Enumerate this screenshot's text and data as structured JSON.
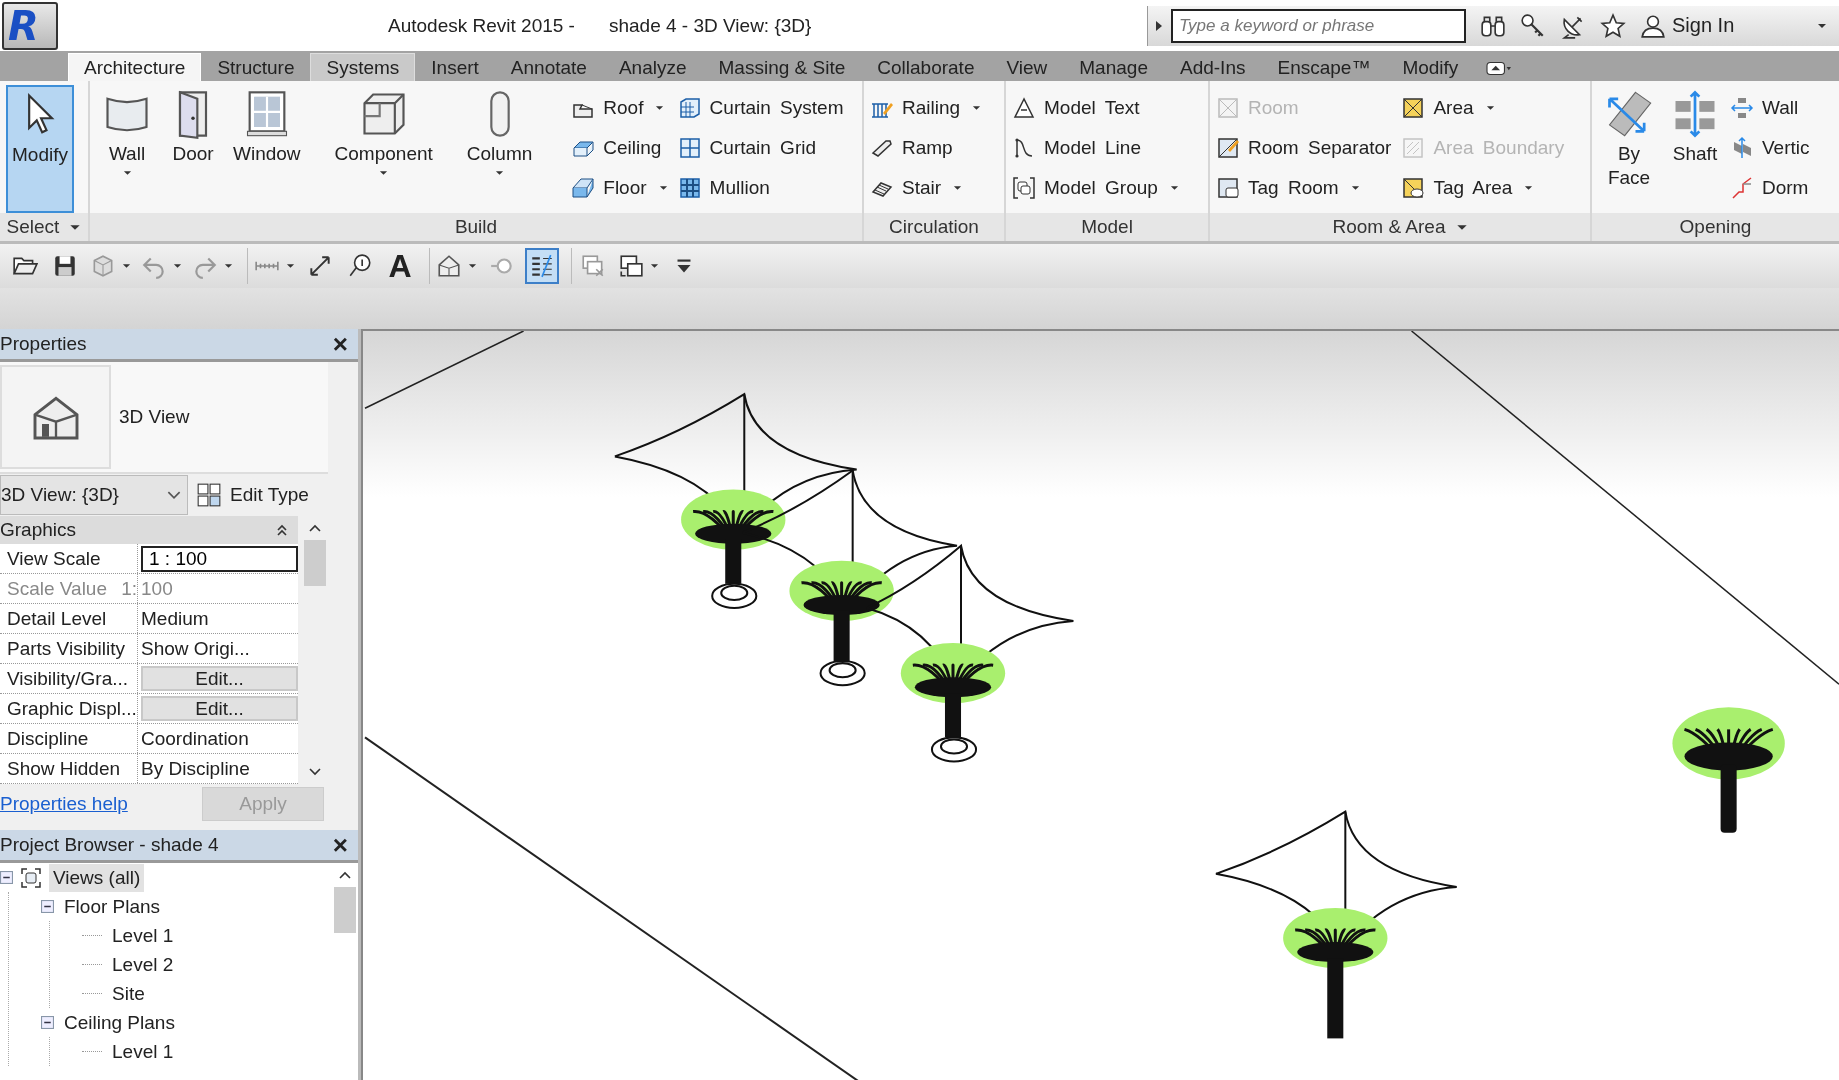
{
  "app_menu": {
    "logo": "R"
  },
  "title_bar": {
    "app": "Autodesk Revit 2015 -",
    "document": "shade 4 - 3D View: {3D}",
    "search": {
      "placeholder": "Type a keyword or phrase"
    },
    "sign_in": "Sign In"
  },
  "tabs": [
    {
      "label": "Architecture",
      "selected": true,
      "hovered": false
    },
    {
      "label": "Structure",
      "selected": false,
      "hovered": false
    },
    {
      "label": "Systems",
      "selected": false,
      "hovered": true
    },
    {
      "label": "Insert",
      "selected": false,
      "hovered": false
    },
    {
      "label": "Annotate",
      "selected": false,
      "hovered": false
    },
    {
      "label": "Analyze",
      "selected": false,
      "hovered": false
    },
    {
      "label": "Massing & Site",
      "selected": false,
      "hovered": false
    },
    {
      "label": "Collaborate",
      "selected": false,
      "hovered": false
    },
    {
      "label": "View",
      "selected": false,
      "hovered": false
    },
    {
      "label": "Manage",
      "selected": false,
      "hovered": false
    },
    {
      "label": "Add-Ins",
      "selected": false,
      "hovered": false
    },
    {
      "label": "Enscape™",
      "selected": false,
      "hovered": false
    },
    {
      "label": "Modify",
      "selected": false,
      "hovered": false
    }
  ],
  "ribbon": {
    "panels": [
      {
        "label": "Select",
        "has_menu": true,
        "large": [
          {
            "label": "Modify",
            "dropdown": false,
            "selected": true
          }
        ]
      },
      {
        "label": "Build",
        "has_menu": false,
        "large": [
          {
            "label": "Wall",
            "dropdown": true,
            "selected": false
          },
          {
            "label": "Door",
            "dropdown": false,
            "selected": false
          },
          {
            "label": "Window",
            "dropdown": false,
            "selected": false
          },
          {
            "label": "Component",
            "dropdown": true,
            "selected": false
          },
          {
            "label": "Column",
            "dropdown": true,
            "selected": false
          }
        ],
        "columns": [
          [
            {
              "label": "Roof",
              "dropdown": true,
              "disabled": false
            },
            {
              "label": "Ceiling",
              "dropdown": false,
              "disabled": false
            },
            {
              "label": "Floor",
              "dropdown": true,
              "disabled": false
            }
          ],
          [
            {
              "label": "Curtain System",
              "dropdown": false,
              "disabled": false
            },
            {
              "label": "Curtain Grid",
              "dropdown": false,
              "disabled": false
            },
            {
              "label": "Mullion",
              "dropdown": false,
              "disabled": false
            }
          ]
        ]
      },
      {
        "label": "Circulation",
        "has_menu": false,
        "columns": [
          [
            {
              "label": "Railing",
              "dropdown": true,
              "disabled": false
            },
            {
              "label": "Ramp",
              "dropdown": false,
              "disabled": false
            },
            {
              "label": "Stair",
              "dropdown": true,
              "disabled": false
            }
          ]
        ]
      },
      {
        "label": "Model",
        "has_menu": false,
        "columns": [
          [
            {
              "label": "Model Text",
              "dropdown": false,
              "disabled": false
            },
            {
              "label": "Model Line",
              "dropdown": false,
              "disabled": false
            },
            {
              "label": "Model Group",
              "dropdown": true,
              "disabled": false
            }
          ]
        ]
      },
      {
        "label": "Room & Area",
        "has_menu": true,
        "columns": [
          [
            {
              "label": "Room",
              "dropdown": false,
              "disabled": true
            },
            {
              "label": "Room Separator",
              "dropdown": false,
              "disabled": false
            },
            {
              "label": "Tag Room",
              "dropdown": true,
              "disabled": false
            }
          ],
          [
            {
              "label": "Area",
              "dropdown": true,
              "disabled": false
            },
            {
              "label": "Area Boundary",
              "dropdown": false,
              "disabled": true
            },
            {
              "label": "Tag Area",
              "dropdown": true,
              "disabled": false
            }
          ]
        ]
      },
      {
        "label": "Opening",
        "has_menu": false,
        "large": [
          {
            "label": "By Face",
            "dropdown": false,
            "selected": false
          },
          {
            "label": "Shaft",
            "dropdown": false,
            "selected": false
          }
        ],
        "columns": [
          [
            {
              "label": "Wall",
              "dropdown": false,
              "disabled": false
            },
            {
              "label": "Vertic",
              "dropdown": false,
              "disabled": false
            },
            {
              "label": "Dorm",
              "dropdown": false,
              "disabled": false
            }
          ]
        ]
      }
    ]
  },
  "quick_access": [
    [
      {
        "dropdown": false,
        "selected": false
      },
      {
        "dropdown": false,
        "selected": false
      },
      {
        "dropdown": true,
        "selected": false
      },
      {
        "dropdown": true,
        "selected": false
      },
      {
        "dropdown": true,
        "selected": false
      }
    ],
    [
      {
        "dropdown": true,
        "selected": false
      },
      {
        "dropdown": false,
        "selected": false
      },
      {
        "dropdown": false,
        "selected": false
      },
      {
        "label": "A",
        "dropdown": false,
        "selected": false
      }
    ],
    [
      {
        "dropdown": true,
        "selected": false
      },
      {
        "dropdown": false,
        "selected": false
      },
      {
        "dropdown": false,
        "selected": true
      }
    ],
    [
      {
        "dropdown": false,
        "selected": false
      },
      {
        "dropdown": true,
        "selected": false
      },
      {
        "dropdown": false,
        "selected": false
      }
    ]
  ],
  "properties": {
    "title": "Properties",
    "close": "×",
    "type_name": "3D View",
    "selector": "3D View: {3D}",
    "edit_type": "Edit Type",
    "group": {
      "label": "Graphics",
      "expanded": true
    },
    "rows": [
      {
        "kind": "field",
        "name": "View Scale",
        "value": "1 : 100"
      },
      {
        "kind": "readonly",
        "name": "Scale Value",
        "prefix": "1:",
        "value": "100"
      },
      {
        "kind": "text",
        "name": "Detail Level",
        "value": "Medium"
      },
      {
        "kind": "text",
        "name": "Parts Visibility",
        "value": "Show Origi..."
      },
      {
        "kind": "button",
        "name": "Visibility/Gra...",
        "value": "Edit..."
      },
      {
        "kind": "button",
        "name": "Graphic Displ...",
        "value": "Edit..."
      },
      {
        "kind": "text",
        "name": "Discipline",
        "value": "Coordination"
      },
      {
        "kind": "text",
        "name": "Show Hidden",
        "value": "By Discipline"
      }
    ],
    "help": "Properties help",
    "apply": {
      "label": "Apply",
      "disabled": true
    }
  },
  "project_browser": {
    "title": "Project Browser - shade 4",
    "close": "×",
    "tree": [
      {
        "label": "Views (all)",
        "expanded": true,
        "selected": true,
        "children": [
          {
            "label": "Floor Plans",
            "expanded": true,
            "selected": false,
            "children": [
              {
                "label": "Level 1",
                "selected": false
              },
              {
                "label": "Level 2",
                "selected": false
              },
              {
                "label": "Site",
                "selected": false
              }
            ]
          },
          {
            "label": "Ceiling Plans",
            "expanded": true,
            "selected": false,
            "children": [
              {
                "label": "Level 1",
                "selected": false
              }
            ]
          }
        ]
      }
    ]
  }
}
